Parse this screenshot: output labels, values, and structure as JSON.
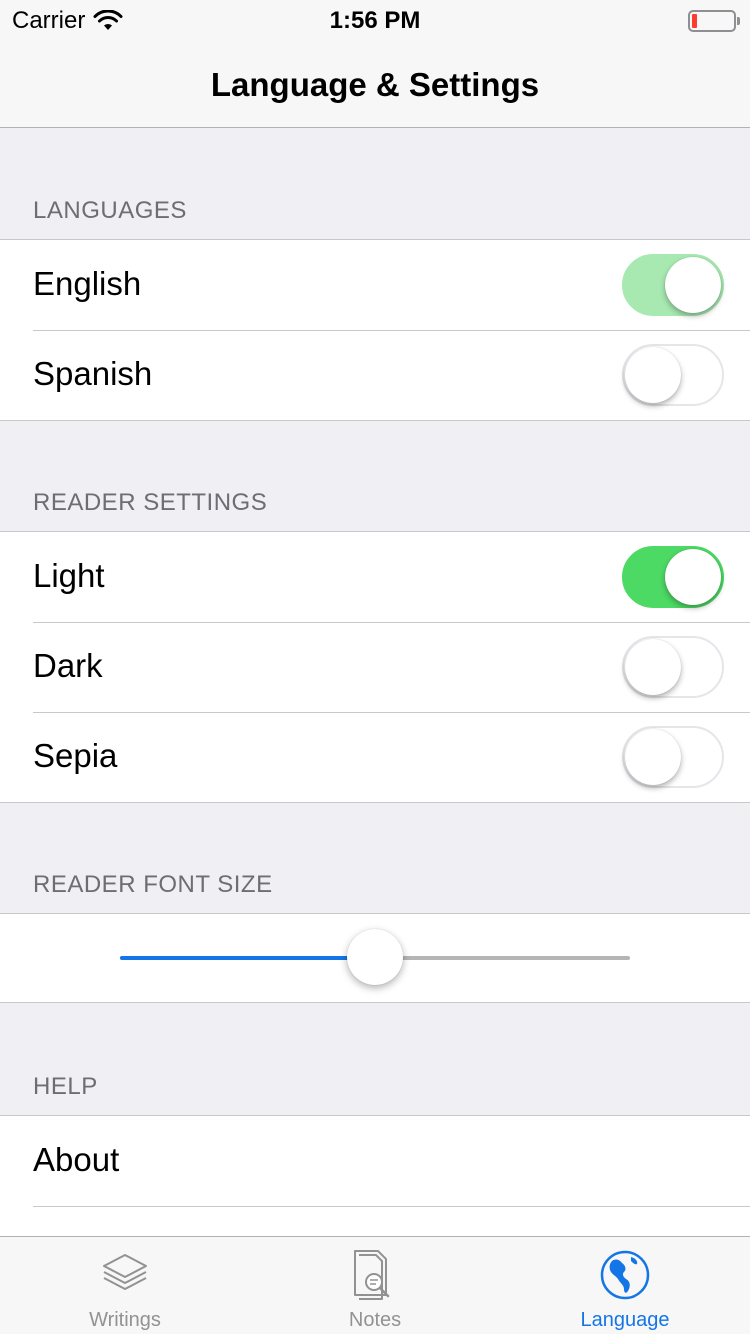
{
  "status_bar": {
    "carrier": "Carrier",
    "time": "1:56 PM"
  },
  "nav": {
    "title": "Language & Settings"
  },
  "sections": {
    "languages": {
      "header": "LANGUAGES",
      "rows": [
        {
          "label": "English",
          "on": true
        },
        {
          "label": "Spanish",
          "on": false
        }
      ]
    },
    "reader_settings": {
      "header": "READER SETTINGS",
      "rows": [
        {
          "label": "Light",
          "on": true
        },
        {
          "label": "Dark",
          "on": false
        },
        {
          "label": "Sepia",
          "on": false
        }
      ]
    },
    "reader_font_size": {
      "header": "READER FONT SIZE",
      "value": 0.5
    },
    "help": {
      "header": "HELP",
      "rows": [
        {
          "label": "About"
        }
      ]
    }
  },
  "tab_bar": {
    "tabs": [
      {
        "label": "Writings",
        "icon": "layers-icon",
        "active": false
      },
      {
        "label": "Notes",
        "icon": "note-search-icon",
        "active": false
      },
      {
        "label": "Language",
        "icon": "globe-icon",
        "active": true
      }
    ]
  },
  "colors": {
    "accent": "#1476e6",
    "toggle_on": "#4cd964",
    "background": "#efeff4"
  }
}
